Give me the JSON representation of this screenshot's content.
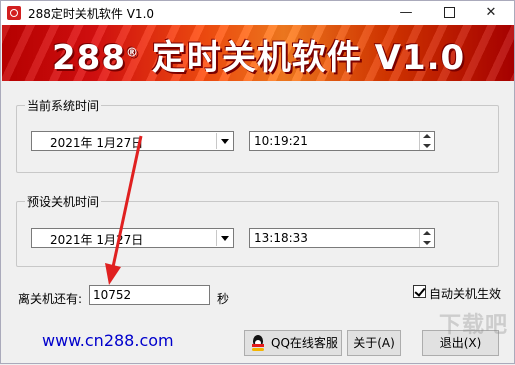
{
  "window": {
    "title": "288定时关机软件 V1.0",
    "minimize_glyph": "—",
    "close_glyph": "✕"
  },
  "banner": {
    "text": "288",
    "registered": "®",
    "subtitle": "定时关机软件 V1.0"
  },
  "current_time": {
    "group_label": "当前系统时间",
    "date": "2021年  1月27日",
    "time": "10:19:21"
  },
  "preset_time": {
    "group_label": "预设关机时间",
    "date": "2021年  1月27日",
    "time": "13:18:33"
  },
  "remaining": {
    "label": "离关机还有:",
    "value": "10752",
    "unit": "秒"
  },
  "auto_shutdown": {
    "label": "自动关机生效",
    "checked": true
  },
  "website": "www.cn288.com",
  "buttons": {
    "qq": "QQ在线客服",
    "about": "关于(A)",
    "exit": "退出(X)"
  },
  "watermark": "下载吧",
  "colors": {
    "banner_red": "#c40000",
    "banner_orange": "#ff8020",
    "link_blue": "#0000cc",
    "arrow_red": "#e02020"
  },
  "icons": [
    "app-icon",
    "dropdown-icon",
    "spin-icon",
    "qq-penguin-icon",
    "checkmark-icon"
  ]
}
